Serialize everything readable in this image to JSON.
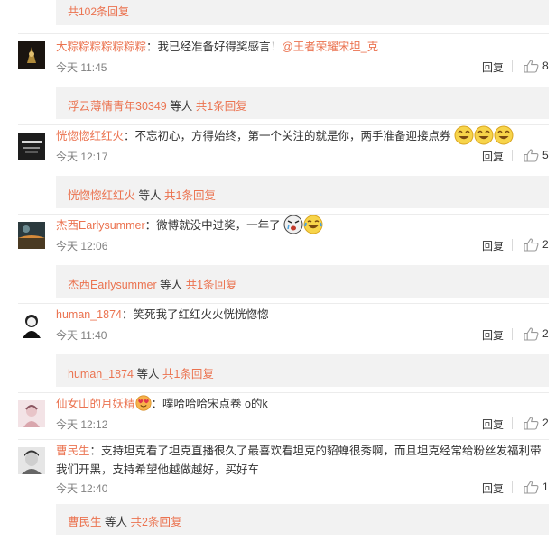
{
  "top_bar": {
    "total_label": "共102条回复"
  },
  "ui": {
    "reply_label": "回复",
    "etc_label": "等人"
  },
  "comments": [
    {
      "name": "大粽粽粽粽粽粽粽",
      "sep": "：",
      "text": "我已经准备好得奖感言！",
      "mention": "@王者荣耀宋坦_克",
      "time": "今天 11:45",
      "likes": "8",
      "sub_names": "浮云薄情青年30349",
      "sub_total": "共1条回复"
    },
    {
      "name": "恍惚惚红红火",
      "sep": "：",
      "text": "不忘初心，方得始终，第一个关注的就是你，两手准备迎接点券",
      "time": "今天 12:17",
      "likes": "5",
      "sub_names": "恍惚惚红红火",
      "sub_total": "共1条回复"
    },
    {
      "name": "杰西Earlysummer",
      "sep": "：",
      "text": "微博就没中过奖，一年了",
      "time": "今天 12:06",
      "likes": "2",
      "sub_names": "杰西Earlysummer",
      "sub_total": "共1条回复"
    },
    {
      "name": "human_1874",
      "sep": "：",
      "text": "笑死我了红红火火恍恍惚惚",
      "time": "今天 11:40",
      "likes": "2",
      "sub_names": "human_1874",
      "sub_total": "共1条回复"
    },
    {
      "name": "仙女山的月妖精",
      "sep": "：",
      "text": "噗哈哈哈宋点卷  o的k",
      "time": "今天 12:12",
      "likes": "2"
    },
    {
      "name": "曹民生",
      "sep": "：",
      "text": "支持坦克看了坦克直播很久了最喜欢看坦克的貂蝉很秀啊，而且坦克经常给粉丝发福利带我们开黑，支持希望他越做越好，买好车",
      "time": "今天 12:40",
      "likes": "1",
      "sub_names": "曹民生",
      "sub_total": "共2条回复"
    }
  ]
}
